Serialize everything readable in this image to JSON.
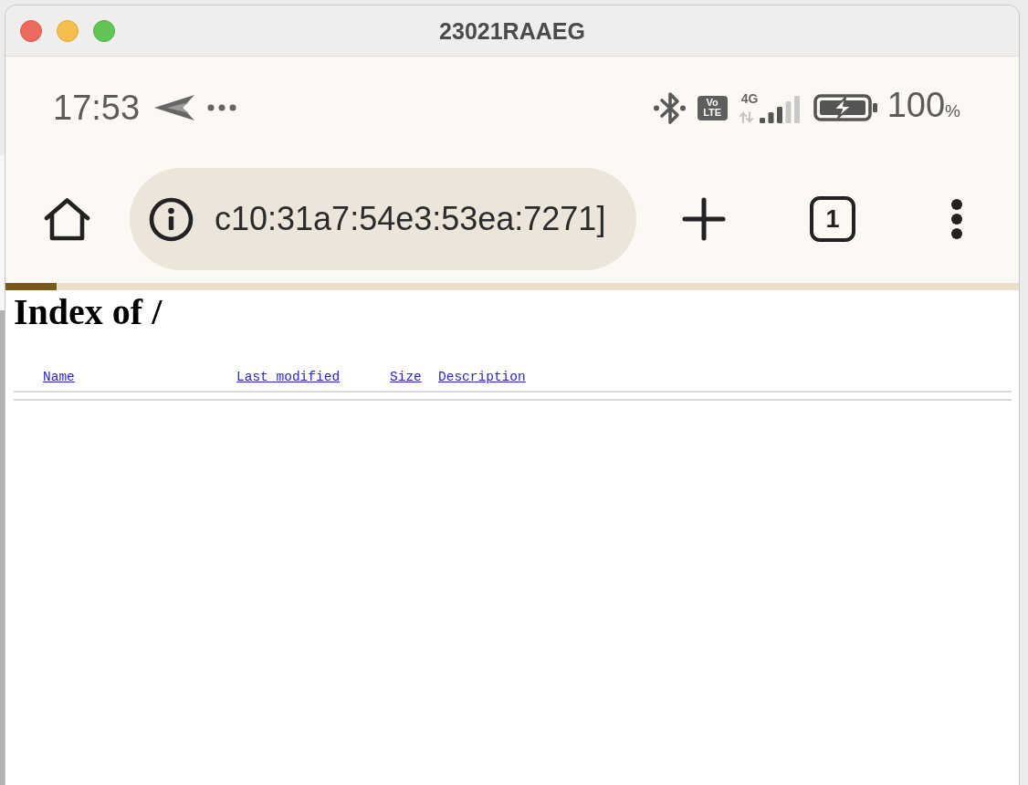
{
  "window": {
    "title": "23021RAAEG"
  },
  "status_bar": {
    "time": "17:53",
    "volte_badge": [
      "Vo",
      "LTE"
    ],
    "network_type": "4G",
    "battery": "100%"
  },
  "toolbar": {
    "url": "c10:31a7:54e3:53ea:7271]",
    "tab_count": "1"
  },
  "progress": {
    "level": 0.05
  },
  "page": {
    "heading": "Index of /",
    "columns": [
      "Name",
      "Last modified",
      "Size",
      "Description"
    ]
  }
}
